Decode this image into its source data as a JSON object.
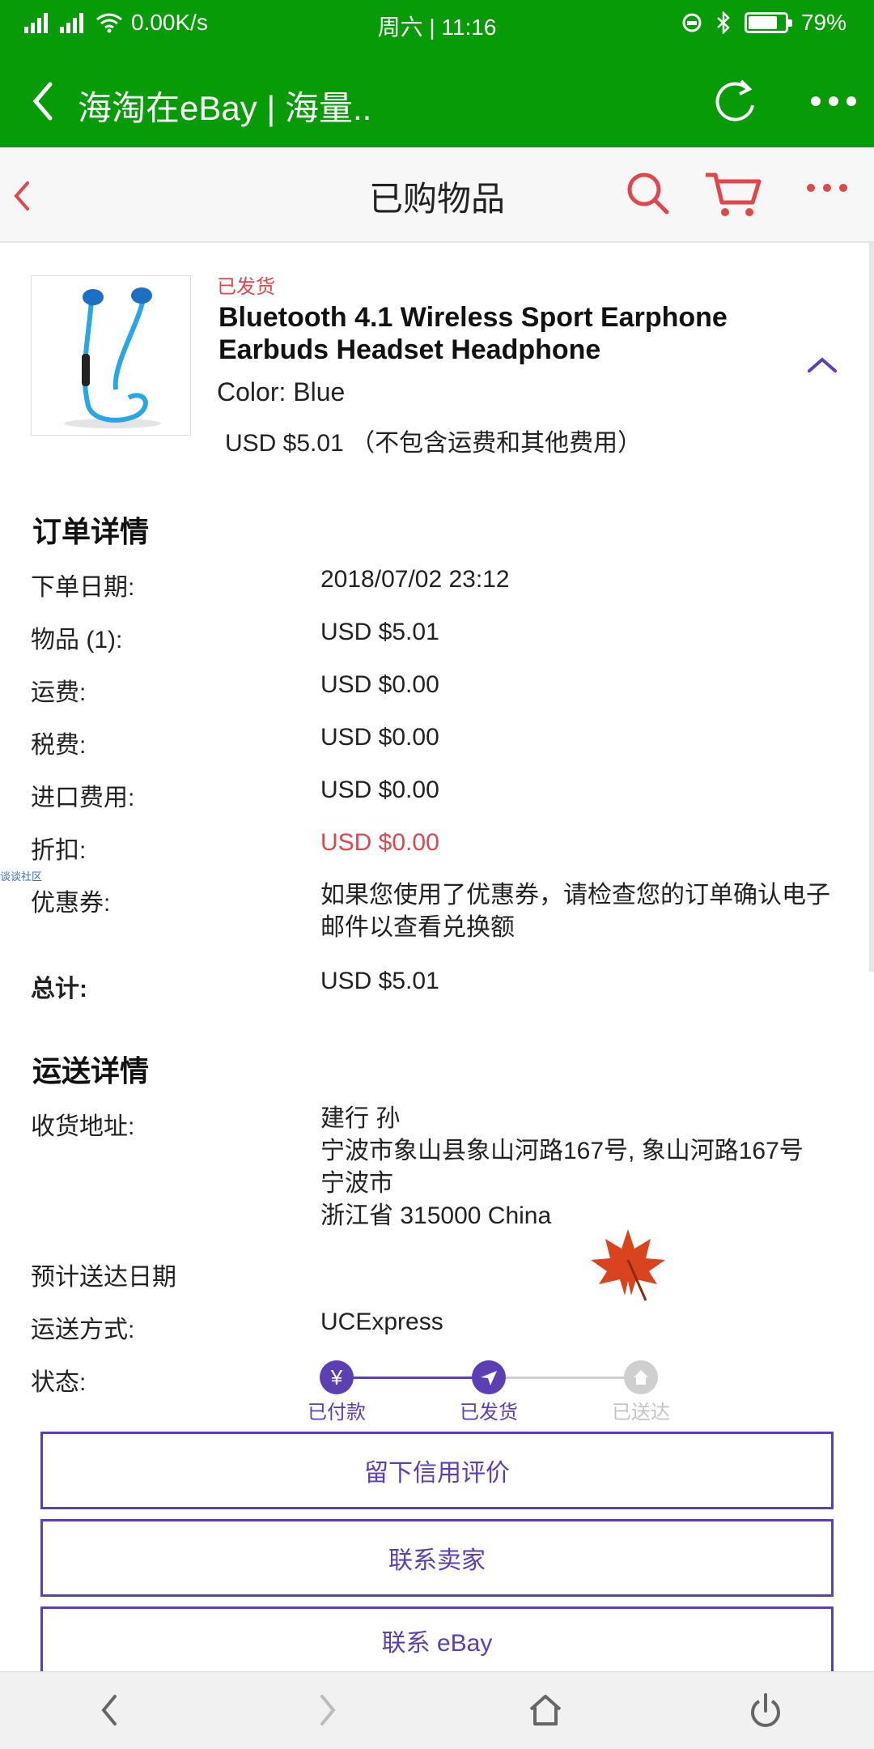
{
  "status_bar": {
    "net_speed": "0.00K/s",
    "time": "周六 | 11:16",
    "battery": "79%",
    "battery_level": 0.79
  },
  "browser": {
    "title": "海淘在eBay | 海量.."
  },
  "app_header": {
    "title": "已购物品"
  },
  "product": {
    "status": "已发货",
    "title": "Bluetooth 4.1 Wireless Sport Earphone Earbuds Headset Headphone",
    "color": "Color: Blue",
    "price": "USD $5.01 （不包含运费和其他费用）"
  },
  "order_details": {
    "title": "订单详情",
    "rows": [
      {
        "label": "下单日期:",
        "value": "2018/07/02 23:12"
      },
      {
        "label": "物品 (1):",
        "value": "USD $5.01"
      },
      {
        "label": "运费:",
        "value": "USD $0.00"
      },
      {
        "label": "税费:",
        "value": "USD $0.00"
      },
      {
        "label": "进口费用:",
        "value": "USD $0.00"
      },
      {
        "label": "折扣:",
        "value": "USD $0.00"
      },
      {
        "label": "优惠券:",
        "value": "如果您使用了优惠券，请检查您的订单确认电子邮件以查看兑换额"
      },
      {
        "label": "总计:",
        "value": "USD $5.01"
      }
    ],
    "watermark": "谈谈社区"
  },
  "shipping_details": {
    "title": "运送详情",
    "address_label": "收货地址:",
    "address_lines": [
      "建行 孙",
      "宁波市象山县象山河路167号, 象山河路167号",
      "宁波市",
      "浙江省 315000 China"
    ],
    "eta_label": "预计送达日期",
    "method_label": "运送方式:",
    "method_value": "UCExpress",
    "status_label": "状态:",
    "steps": [
      {
        "label": "已付款",
        "icon": "yen-icon",
        "state": "done"
      },
      {
        "label": "已发货",
        "icon": "plane-icon",
        "state": "done"
      },
      {
        "label": "已送达",
        "icon": "home-icon",
        "state": "pending"
      }
    ]
  },
  "actions": {
    "feedback": "留下信用评价",
    "contact_seller": "联系卖家",
    "contact_ebay": "联系 eBay"
  },
  "colors": {
    "browser_green": "#079b07",
    "accent_purple": "#5b3fb3",
    "red": "#e0474c"
  }
}
